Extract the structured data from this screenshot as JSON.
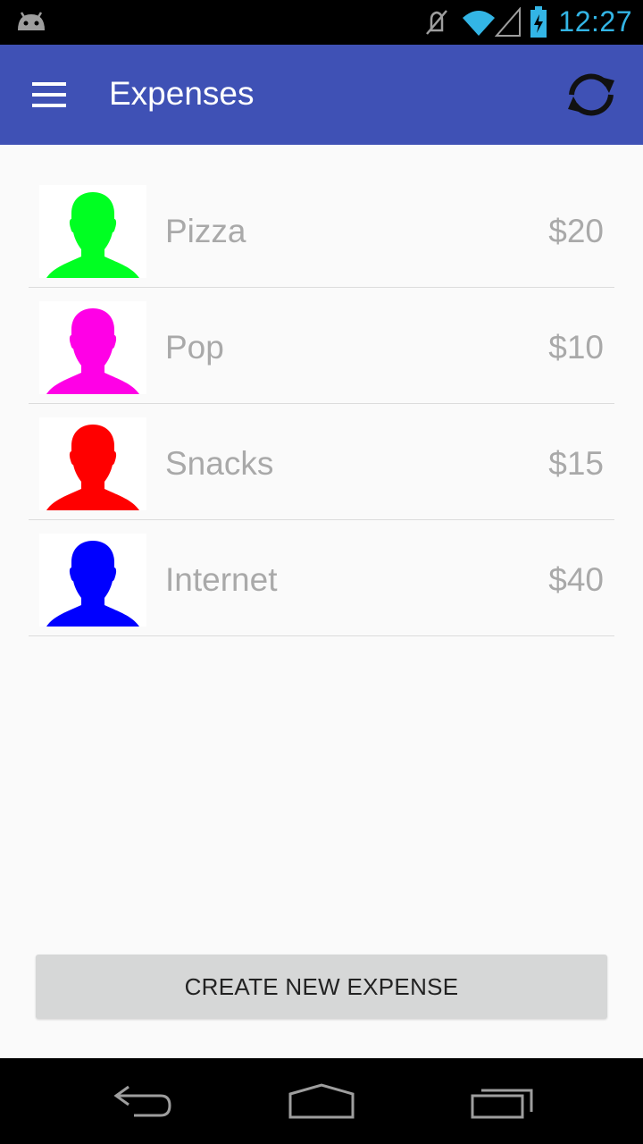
{
  "status_bar": {
    "time": "12:27",
    "icons": [
      "android-debug-icon",
      "mute-icon",
      "wifi-icon",
      "signal-icon",
      "battery-charging-icon"
    ]
  },
  "app_bar": {
    "title": "Expenses",
    "menu_icon": "hamburger-menu-icon",
    "action_icon": "refresh-icon"
  },
  "expenses": [
    {
      "name": "Pizza",
      "amount": "$20",
      "avatar_color": "#00ff22",
      "avatar_icon": "person-silhouette-icon"
    },
    {
      "name": "Pop",
      "amount": "$10",
      "avatar_color": "#ff00e6",
      "avatar_icon": "person-silhouette-icon"
    },
    {
      "name": "Snacks",
      "amount": "$15",
      "avatar_color": "#ff0000",
      "avatar_icon": "person-silhouette-icon"
    },
    {
      "name": "Internet",
      "amount": "$40",
      "avatar_color": "#0000ff",
      "avatar_icon": "person-silhouette-icon"
    }
  ],
  "create_button": {
    "label": "CREATE NEW EXPENSE"
  },
  "nav_bar": {
    "icons": [
      "back-icon",
      "home-icon",
      "recents-icon"
    ]
  },
  "colors": {
    "app_bar": "#3f51b5",
    "status_text": "#33b5e5",
    "list_text": "#a9a9a9",
    "button_bg": "#d6d7d7"
  }
}
